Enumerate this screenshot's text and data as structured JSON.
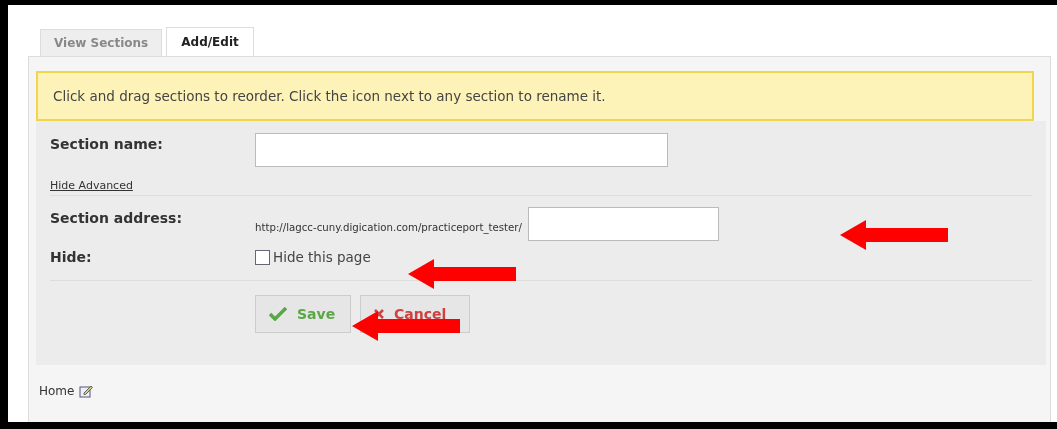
{
  "tabs": [
    {
      "label": "View Sections",
      "selected": false
    },
    {
      "label": "Add/Edit",
      "selected": true
    }
  ],
  "notice": "Click and drag sections to reorder. Click the icon next to any section to rename it.",
  "form": {
    "section_name_label": "Section name:",
    "advanced_link": "Hide Advanced",
    "section_address_label": "Section address:",
    "address_prefix": "http://lagcc-cuny.digication.com/practiceport_tester/",
    "hide_label": "Hide:",
    "hide_checkbox": {
      "label": "Hide this page",
      "checked": false
    }
  },
  "buttons": [
    {
      "kind": "save",
      "label": "Save"
    },
    {
      "kind": "cancel",
      "label": "Cancel"
    }
  ],
  "footer": {
    "link": "Home"
  }
}
